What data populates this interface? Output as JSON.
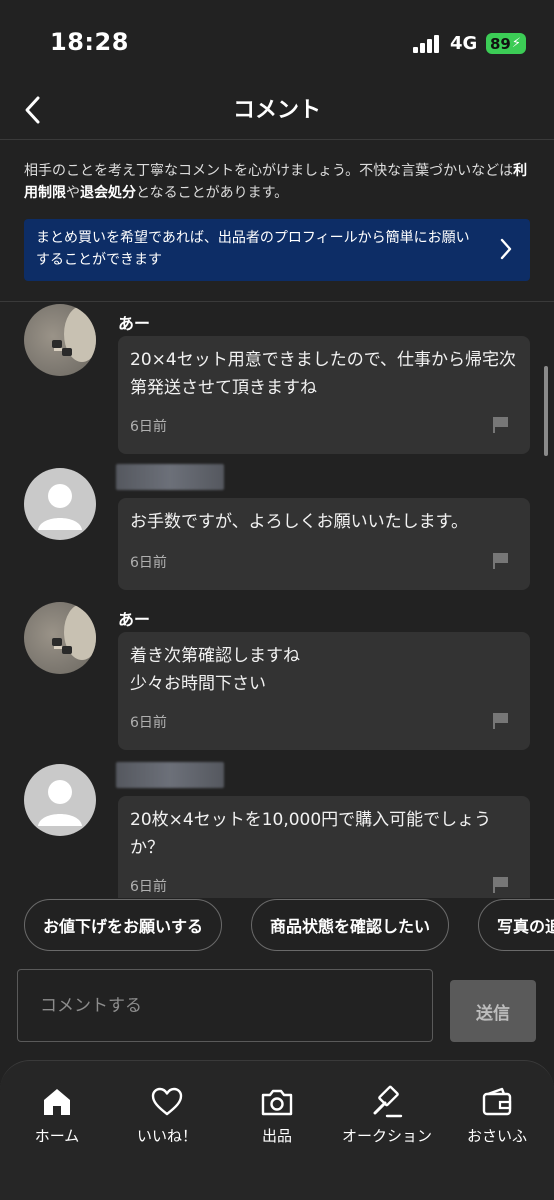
{
  "status_bar": {
    "time": "18:28",
    "network": "4G",
    "battery": "89"
  },
  "header": {
    "title": "コメント"
  },
  "notice": {
    "part1": "相手のことを考え丁寧なコメントを心がけましょう。不快な言葉づかいなどは",
    "bold1": "利用制限",
    "part2": "や",
    "bold2": "退会処分",
    "part3": "となることがあります。"
  },
  "banner": {
    "text": "まとめ買いを希望であれば、出品者のプロフィールから簡単にお願いすることができます"
  },
  "comments": [
    {
      "username": "あー",
      "text": "20×4セット用意できましたので、仕事から帰宅次第発送させて頂きますね",
      "time": "6日前"
    },
    {
      "username": "",
      "text": "お手数ですが、よろしくお願いいたします。",
      "time": "6日前"
    },
    {
      "username": "あー",
      "text": "着き次第確認しますね\n少々お時間下さい",
      "time": "6日前"
    },
    {
      "username": "",
      "text": "20枚×4セットを10,000円で購入可能でしょうか？",
      "time": "6日前"
    }
  ],
  "chips": [
    "お値下げをお願いする",
    "商品状態を確認したい",
    "写真の追加"
  ],
  "input": {
    "placeholder": "コメントする",
    "send_label": "送信"
  },
  "tabs": [
    {
      "label": "ホーム",
      "icon": "home-icon"
    },
    {
      "label": "いいね！",
      "icon": "heart-icon"
    },
    {
      "label": "出品",
      "icon": "camera-icon"
    },
    {
      "label": "オークション",
      "icon": "gavel-icon"
    },
    {
      "label": "おさいふ",
      "icon": "wallet-icon"
    }
  ],
  "colors": {
    "background": "#222222",
    "banner": "#0d2d66",
    "battery": "#3ccc56",
    "bubble": "#333333"
  }
}
